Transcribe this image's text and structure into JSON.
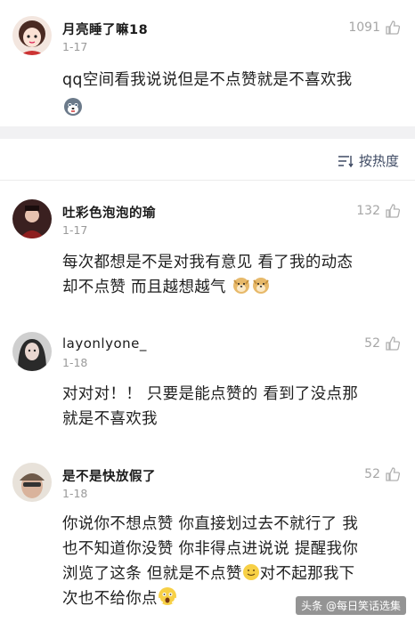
{
  "comments": [
    {
      "user": "月亮睡了嘛18",
      "date": "1-17",
      "likes": "1091",
      "text_lines": [
        "qq空间看我说说但是不点赞就是不喜欢我"
      ]
    },
    {
      "user": "吐彩色泡泡的瑜",
      "date": "1-17",
      "likes": "132",
      "text_lines": [
        "每次都想是不是对我有意见 看了我的动态",
        "却不点赞 而且越想越气"
      ]
    },
    {
      "user": "layonlyone_",
      "date": "1-18",
      "likes": "52",
      "text_lines": [
        "对对对！！ 只要是能点赞的 看到了没点那",
        "就是不喜欢我"
      ]
    },
    {
      "user": "是不是快放假了",
      "date": "1-18",
      "likes": "52",
      "text_lines": [
        "你说你不想点赞 你直接划过去不就行了 我",
        "也不知道你没赞 你非得点进说说 提醒我你",
        "浏览了这条 但就是不点赞",
        "对不起那我下",
        "次也不给你点"
      ]
    }
  ],
  "sort": {
    "label": "按热度"
  },
  "watermark": "头条 @每日笑话选集",
  "icons": [
    "like-icon",
    "sort-icon",
    "husky-emoji-icon",
    "doge-emoji-icon",
    "smile-emoji-icon",
    "scream-emoji-icon"
  ],
  "colors": {
    "band": "#f1f1f3",
    "sort_text": "#3e4a63",
    "meta": "#9a9a9a"
  }
}
